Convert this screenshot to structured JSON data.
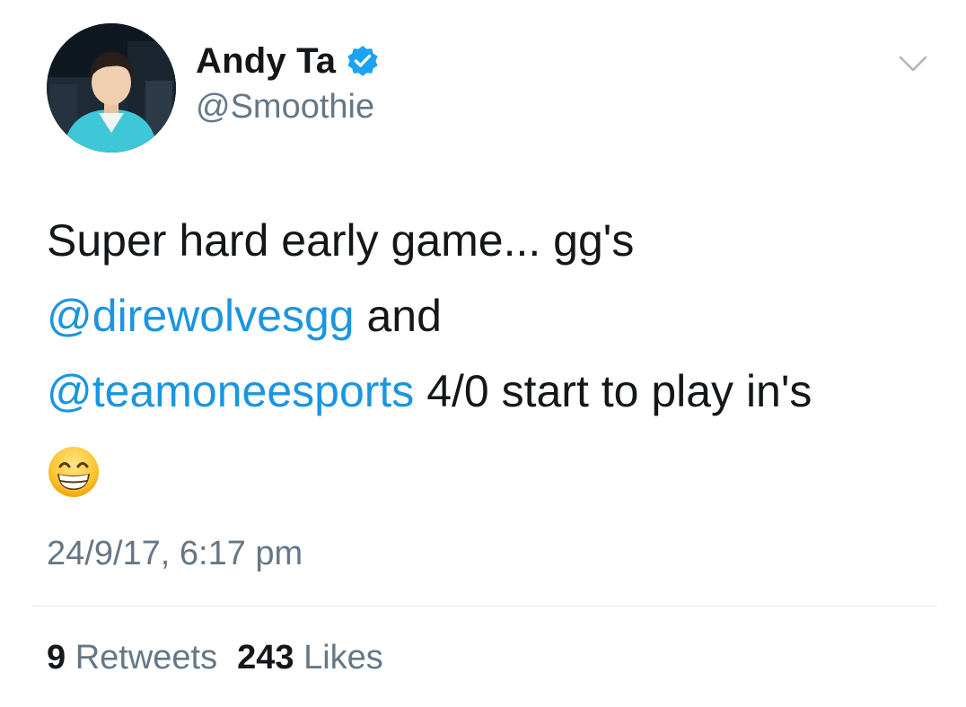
{
  "author": {
    "display_name": "Andy Ta",
    "handle": "@Smoothie",
    "verified": true,
    "avatar_icon": "profile-photo"
  },
  "menu_icon": "chevron-down-icon",
  "tweet": {
    "line1": "Super hard early game... gg's",
    "mention1": "@direwolvesgg",
    "line2_rest": " and",
    "mention2": "@teamoneesports",
    "line3_rest": " 4/0 start to play in's",
    "emoji": "grinning-face-with-smiling-eyes"
  },
  "timestamp": "24/9/17, 6:17 pm",
  "stats": {
    "retweets_count": "9",
    "retweets_label": "Retweets",
    "likes_count": "243",
    "likes_label": "Likes"
  },
  "colors": {
    "link": "#1b95e0",
    "verified_badge": "#1da1f2",
    "secondary_text": "#657786",
    "primary_text": "#14171a"
  }
}
